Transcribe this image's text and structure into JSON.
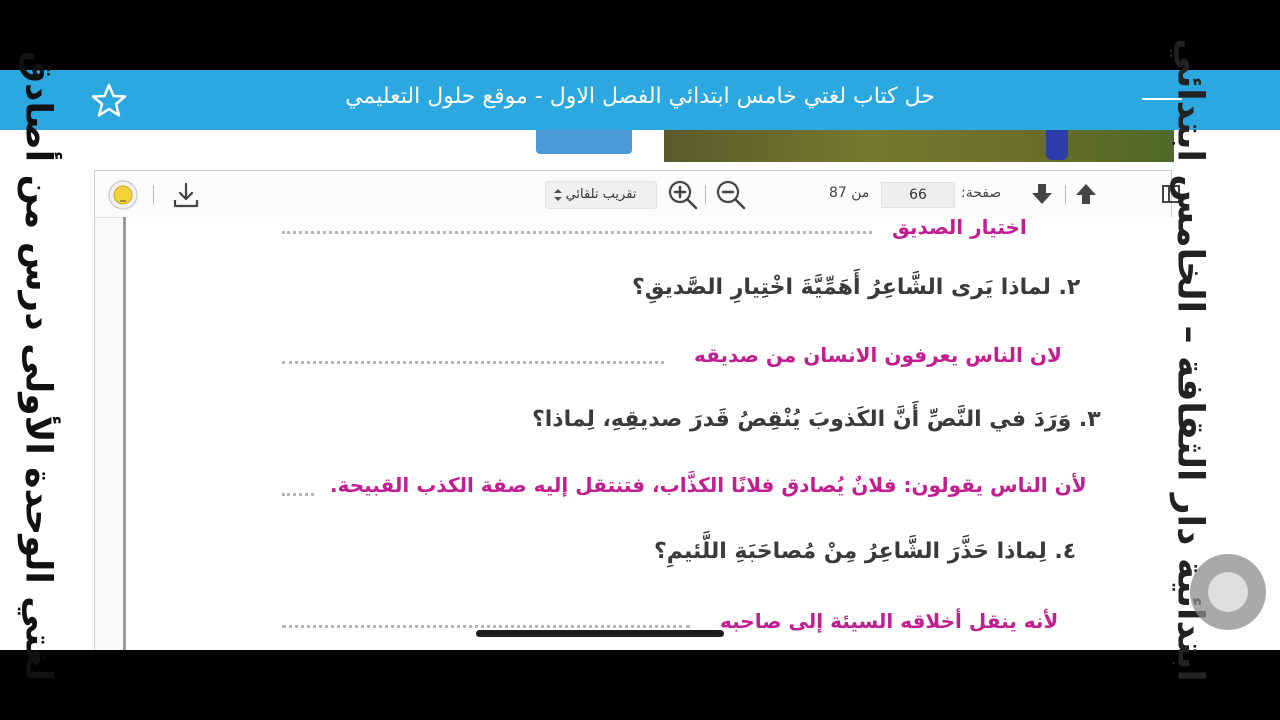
{
  "header": {
    "title": "حل كتاب لغتي خامس ابتدائي الفصل الاول - موقع حلول التعليمي",
    "bg_color": "#2ba8e0"
  },
  "toolbar": {
    "page_label": "صفحة:",
    "page_number": "66",
    "page_of": "من 87",
    "zoom_value": "تقريب تلقائي"
  },
  "content": {
    "heading_partial": "اختيار الصديق",
    "q2": "٢. لماذا يَرى الشَّاعِرُ أَهَمِّيَّةَ اخْتِيارِ الصَّديقِ؟",
    "a2": "لان الناس يعرفون الانسان من صديقه",
    "q3": "٣. وَرَدَ في النَّصِّ أَنَّ الكَذوبَ يُنْقِصُ قَدرَ صديقِهِ، لِماذا؟",
    "a3": "لأن الناس يقولون: فلانٌ يُصادق فلانًا الكذَّاب، فتنتقل إليه صفة الكذب القبيحة.",
    "q4": "٤. لِماذا حَذَّرَ الشَّاعِرُ مِنْ مُصاحَبَةِ اللَّئيمِ؟",
    "a4_partial": "لأنه ينقل أخلاقه السيئة إلى صاحبه"
  },
  "overlay": {
    "left_caption": "لغتي الوحدة الأولى درس من أصادق",
    "right_caption": "ابتدائية دار الثقافة – الخامس ابتدائي"
  },
  "colors": {
    "answer": "#c21e91",
    "question": "#3a3a3a"
  },
  "icons": [
    "star-icon",
    "menu-icon",
    "download-icon",
    "lightbulb-icon",
    "zoom-in-icon",
    "zoom-out-icon",
    "arrow-up-icon",
    "arrow-down-icon",
    "sidebar-toggle-icon",
    "select-arrows-icon"
  ]
}
